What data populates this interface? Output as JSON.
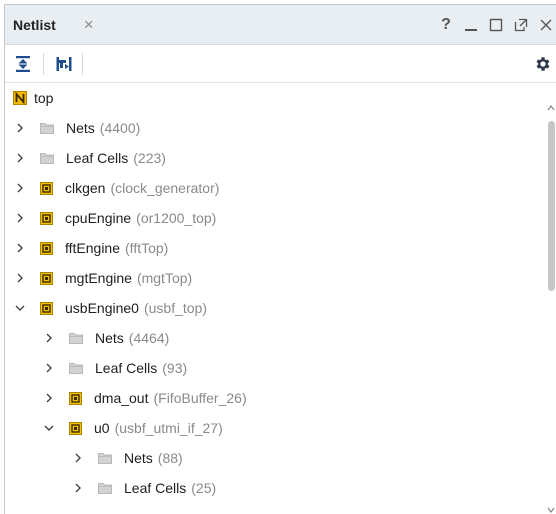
{
  "panel": {
    "title": "Netlist",
    "close_glyph": "×",
    "help_glyph": "?"
  },
  "toolbar": {
    "buttons": [
      {
        "icon": "collapse-all-icon"
      },
      {
        "icon": "flatten-hierarchy-icon"
      }
    ],
    "settings_icon": "gear-icon"
  },
  "tree": {
    "root": {
      "name": "top",
      "icon": "netlist-root-icon"
    },
    "rows": [
      {
        "depth": 0,
        "chevron": "collapsed",
        "icon": "folder",
        "name": "Nets",
        "extra": "(4400)"
      },
      {
        "depth": 0,
        "chevron": "collapsed",
        "icon": "folder",
        "name": "Leaf Cells",
        "extra": "(223)"
      },
      {
        "depth": 0,
        "chevron": "collapsed",
        "icon": "cell",
        "name": "clkgen",
        "extra": "(clock_generator)"
      },
      {
        "depth": 0,
        "chevron": "collapsed",
        "icon": "cell",
        "name": "cpuEngine",
        "extra": "(or1200_top)"
      },
      {
        "depth": 0,
        "chevron": "collapsed",
        "icon": "cell",
        "name": "fftEngine",
        "extra": "(fftTop)"
      },
      {
        "depth": 0,
        "chevron": "collapsed",
        "icon": "cell",
        "name": "mgtEngine",
        "extra": "(mgtTop)"
      },
      {
        "depth": 0,
        "chevron": "expanded",
        "icon": "cell",
        "name": "usbEngine0",
        "extra": "(usbf_top)"
      },
      {
        "depth": 1,
        "chevron": "collapsed",
        "icon": "folder",
        "name": "Nets",
        "extra": "(4464)"
      },
      {
        "depth": 1,
        "chevron": "collapsed",
        "icon": "folder",
        "name": "Leaf Cells",
        "extra": "(93)"
      },
      {
        "depth": 1,
        "chevron": "collapsed",
        "icon": "cell",
        "name": "dma_out",
        "extra": "(FifoBuffer_26)"
      },
      {
        "depth": 1,
        "chevron": "expanded",
        "icon": "cell",
        "name": "u0",
        "extra": "(usbf_utmi_if_27)"
      },
      {
        "depth": 2,
        "chevron": "collapsed",
        "icon": "folder",
        "name": "Nets",
        "extra": "(88)"
      },
      {
        "depth": 2,
        "chevron": "collapsed",
        "icon": "folder",
        "name": "Leaf Cells",
        "extra": "(25)"
      }
    ]
  },
  "colors": {
    "titlebar_bg": "#e9eef3",
    "accent_blue": "#1f4e8c",
    "cell_icon_yellow": "#f2c200",
    "root_icon_yellow": "#f2b705",
    "folder_gray": "#c9c9c9",
    "secondary_text": "#8a8a8a"
  }
}
